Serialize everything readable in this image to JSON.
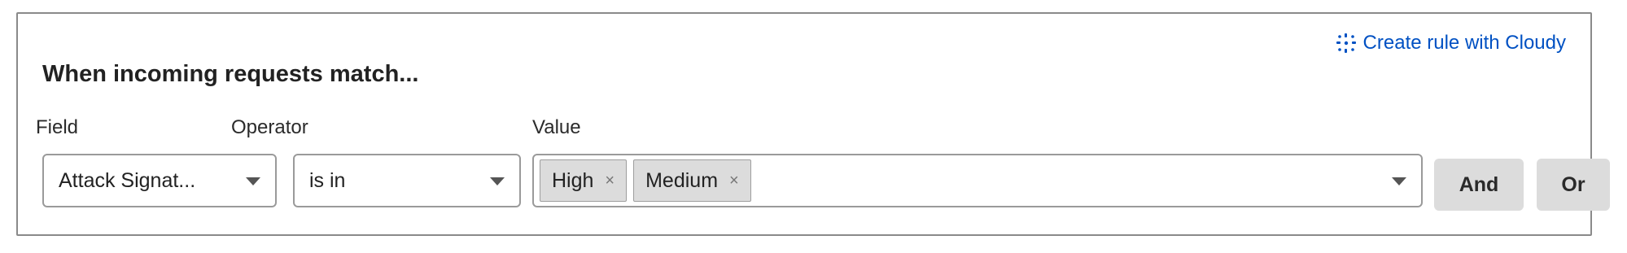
{
  "header": {
    "cloudy_link_label": "Create rule with Cloudy",
    "cloudy_icon": "sparkle-icon",
    "title": "When incoming requests match..."
  },
  "expression": {
    "field": {
      "label": "Field",
      "value": "Attack Signat..."
    },
    "operator": {
      "label": "Operator",
      "value": "is in"
    },
    "value": {
      "label": "Value",
      "chips": [
        {
          "label": "High",
          "remove": "×"
        },
        {
          "label": "Medium",
          "remove": "×"
        }
      ]
    },
    "buttons": {
      "and_label": "And",
      "or_label": "Or"
    }
  },
  "colors": {
    "link": "#0051c3",
    "chip_bg": "#dcdcdc",
    "button_bg": "#dcdcdc",
    "border": "#9a9a9a"
  }
}
